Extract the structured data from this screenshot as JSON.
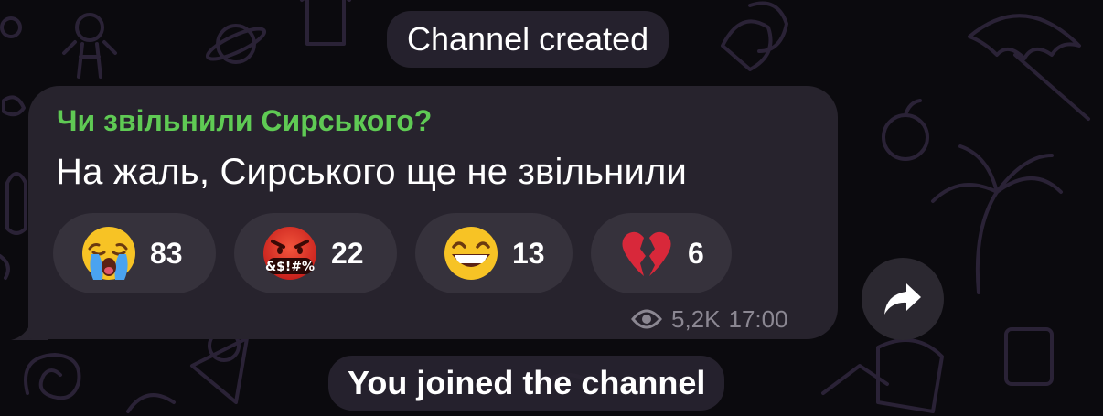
{
  "service": {
    "channel_created": "Channel created",
    "joined": "You joined the channel"
  },
  "message": {
    "sender": "Чи звільнили Сирського?",
    "text": "На жаль, Сирського ще не звільнили",
    "reactions": [
      {
        "emoji": "crying-face",
        "count": "83"
      },
      {
        "emoji": "face-with-symbols-on-mouth",
        "count": "22",
        "symbols": "&$!#%"
      },
      {
        "emoji": "grinning-face",
        "count": "13"
      },
      {
        "emoji": "broken-heart",
        "count": "6"
      }
    ],
    "views": "5,2K",
    "time": "17:00"
  },
  "colors": {
    "background": "#0b0a0e",
    "bubble": "#27232d",
    "reaction_chip": "#36323c",
    "sender": "#5fca54",
    "meta": "#8b8792"
  },
  "icons": {
    "views": "eye-icon",
    "share": "share-arrow-icon"
  }
}
